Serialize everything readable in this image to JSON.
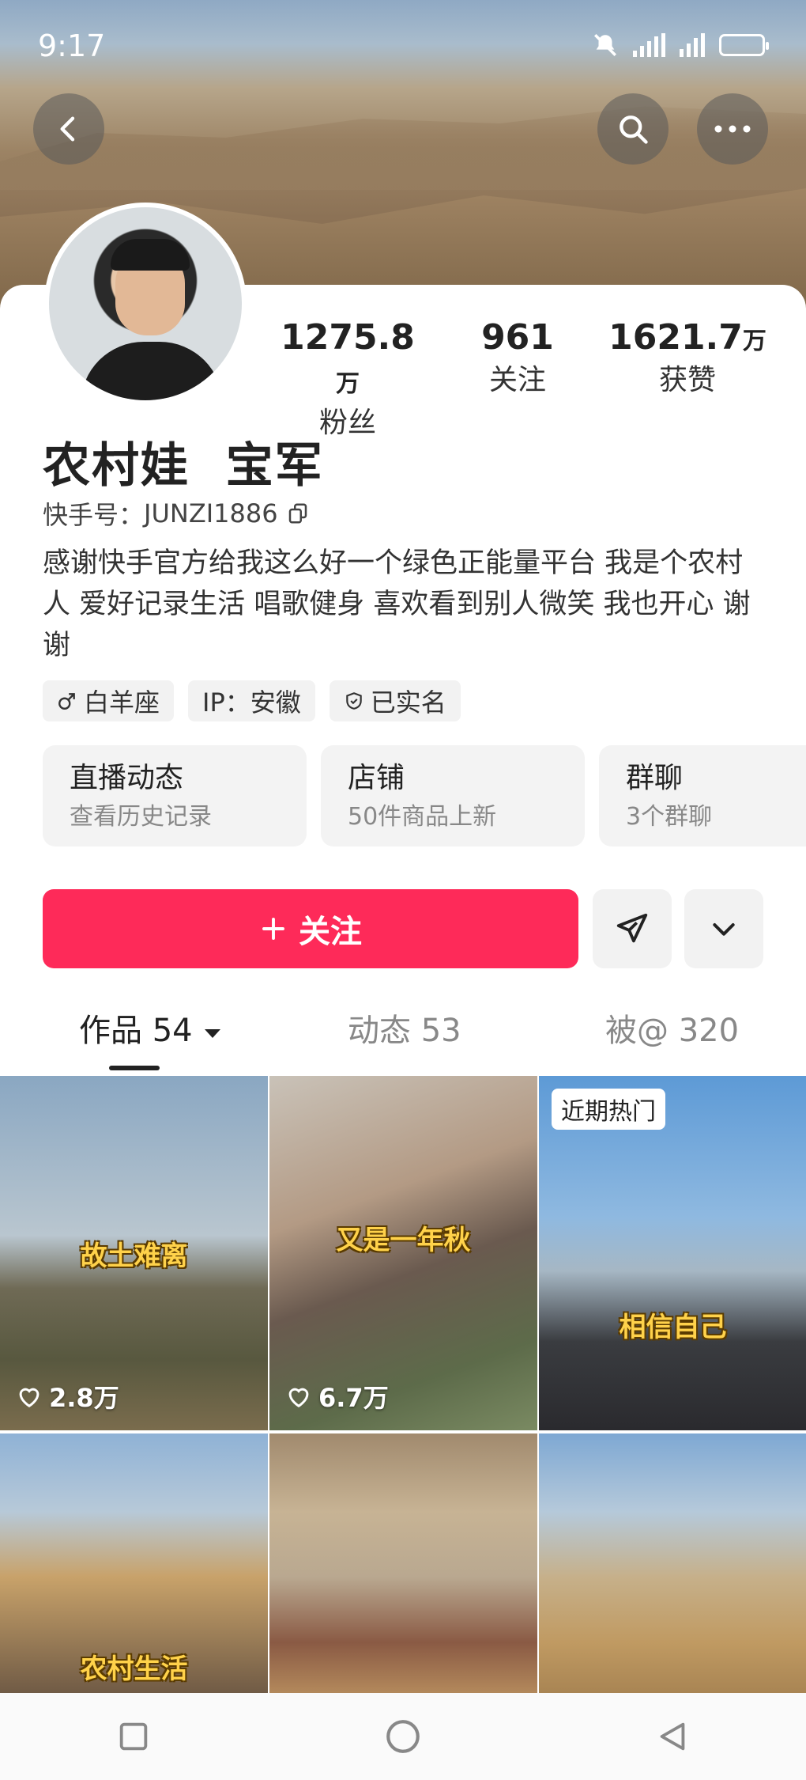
{
  "status_bar": {
    "time": "9:17"
  },
  "profile": {
    "name": "农村娃  宝军",
    "kuaishou_id_label": "快手号：",
    "kuaishou_id": "JUNZI1886",
    "bio": "感谢快手官方给我这么好一个绿色正能量平台 我是个农村人 爱好记录生活 唱歌健身 喜欢看到别人微笑 我也开心 谢谢",
    "stats": [
      {
        "num": "1275.8",
        "unit": "万",
        "label": "粉丝"
      },
      {
        "num": "961",
        "unit": "",
        "label": "关注"
      },
      {
        "num": "1621.7",
        "unit": "万",
        "label": "获赞"
      }
    ],
    "tags": [
      {
        "icon": "male-icon",
        "text": "白羊座"
      },
      {
        "icon": "",
        "text": "IP：安徽"
      },
      {
        "icon": "shield-icon",
        "text": "已实名"
      }
    ]
  },
  "features": [
    {
      "title": "直播动态",
      "subtitle": "查看历史记录"
    },
    {
      "title": "店铺",
      "subtitle": "50件商品上新"
    },
    {
      "title": "群聊",
      "subtitle": "3个群聊"
    }
  ],
  "actions": {
    "follow_label": "关注"
  },
  "tabs": [
    {
      "label": "作品 54",
      "active": true
    },
    {
      "label": "动态 53",
      "active": false
    },
    {
      "label": "被@ 320",
      "active": false
    }
  ],
  "videos": [
    {
      "caption": "故土难离",
      "likes": "2.8万",
      "badge": ""
    },
    {
      "caption": "又是一年秋",
      "likes": "6.7万",
      "badge": ""
    },
    {
      "caption": "相信自己",
      "likes": "",
      "badge": "近期热门"
    },
    {
      "caption": "农村生活",
      "likes": "",
      "badge": ""
    },
    {
      "caption": "",
      "likes": "",
      "badge": ""
    },
    {
      "caption": "",
      "likes": "",
      "badge": ""
    }
  ],
  "colors": {
    "accent": "#fe2a59",
    "chip_bg": "#f2f2f2"
  }
}
